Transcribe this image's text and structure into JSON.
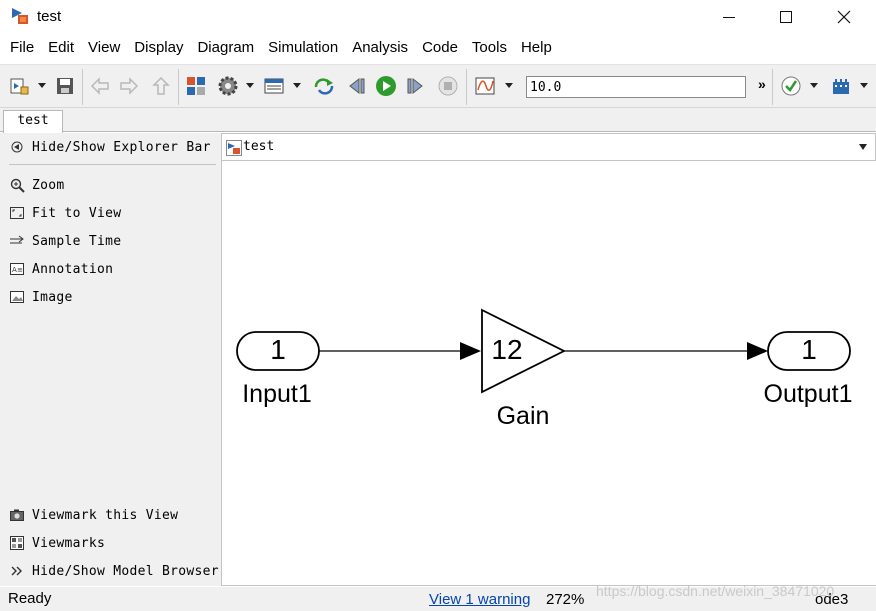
{
  "window": {
    "title": "test",
    "minimize_icon": "minimize-icon",
    "maximize_icon": "maximize-icon",
    "close_icon": "close-icon"
  },
  "menu": [
    "File",
    "Edit",
    "View",
    "Display",
    "Diagram",
    "Simulation",
    "Analysis",
    "Code",
    "Tools",
    "Help"
  ],
  "toolbar": {
    "stop_time": "10.0",
    "overflow": "»",
    "icons": [
      "new-model-icon",
      "save-icon",
      "back-icon",
      "forward-icon",
      "up-icon",
      "library-browser-icon",
      "model-settings-icon",
      "model-explorer-icon",
      "update-diagram-icon",
      "step-back-icon",
      "run-icon",
      "step-forward-icon",
      "stop-icon",
      "scope-icon",
      "model-advisor-icon",
      "build-icon"
    ],
    "run_color": "#2e9b2e"
  },
  "tabs": [
    {
      "label": "test"
    }
  ],
  "explorer": {
    "toggle": "Hide/Show Explorer Bar",
    "items": [
      "Zoom",
      "Fit to View",
      "Sample Time",
      "Annotation",
      "Image"
    ],
    "bottom_items": [
      "Viewmark this View",
      "Viewmarks",
      "Hide/Show Model Browser"
    ]
  },
  "address": {
    "path": "test"
  },
  "diagram": {
    "blocks": [
      {
        "type": "Inport",
        "value": "1",
        "name": "Input1"
      },
      {
        "type": "Gain",
        "value": "12",
        "name": "Gain"
      },
      {
        "type": "Outport",
        "value": "1",
        "name": "Output1"
      }
    ]
  },
  "status": {
    "state": "Ready",
    "warning_link": "View 1 warning",
    "zoom": "272%",
    "solver": "ode3",
    "watermark": "https://blog.csdn.net/weixin_38471020"
  }
}
